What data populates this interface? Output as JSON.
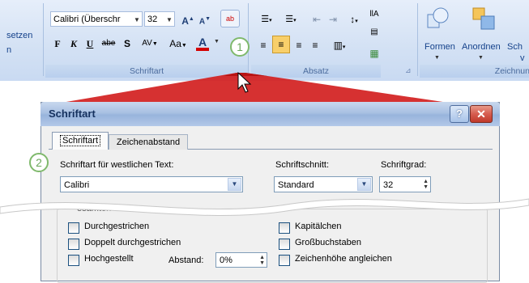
{
  "ribbon": {
    "left_partial": [
      "setzen",
      "n"
    ],
    "font_name": "Calibri (Überschr",
    "font_size": "32",
    "groups": {
      "schriftart": "Schriftart",
      "absatz": "Absatz",
      "zeichnung": "Zeichnun"
    },
    "format_buttons": [
      "F",
      "K",
      "U",
      "abe",
      "S",
      "AV",
      "Aa",
      "A"
    ],
    "drawing_buttons": [
      "Formen",
      "Anordnen",
      "Sch"
    ],
    "drawing_sub": "v"
  },
  "callouts": [
    "1",
    "2"
  ],
  "dialog": {
    "title": "Schriftart",
    "tabs": [
      "Schriftart",
      "Zeichenabstand"
    ],
    "western_label": "Schriftart für westlichen Text:",
    "western_value": "Calibri",
    "style_label": "Schriftschnitt:",
    "style_value": "Standard",
    "size_label": "Schriftgrad:",
    "size_value": "32",
    "section_label": "esamten Text",
    "effects_left": [
      "Durchgestrichen",
      "Doppelt durchgestrichen",
      "Hochgestellt"
    ],
    "effects_right": [
      "Kapitälchen",
      "Großbuchstaben",
      "Zeichenhöhe angleichen"
    ],
    "offset_label": "Abstand:",
    "offset_value": "0%"
  },
  "colors": {
    "ribbon_text": "#15428b",
    "callout_border": "#7fb96c",
    "close_button": "#d65c4f",
    "font_color_bar": "#d40000"
  }
}
